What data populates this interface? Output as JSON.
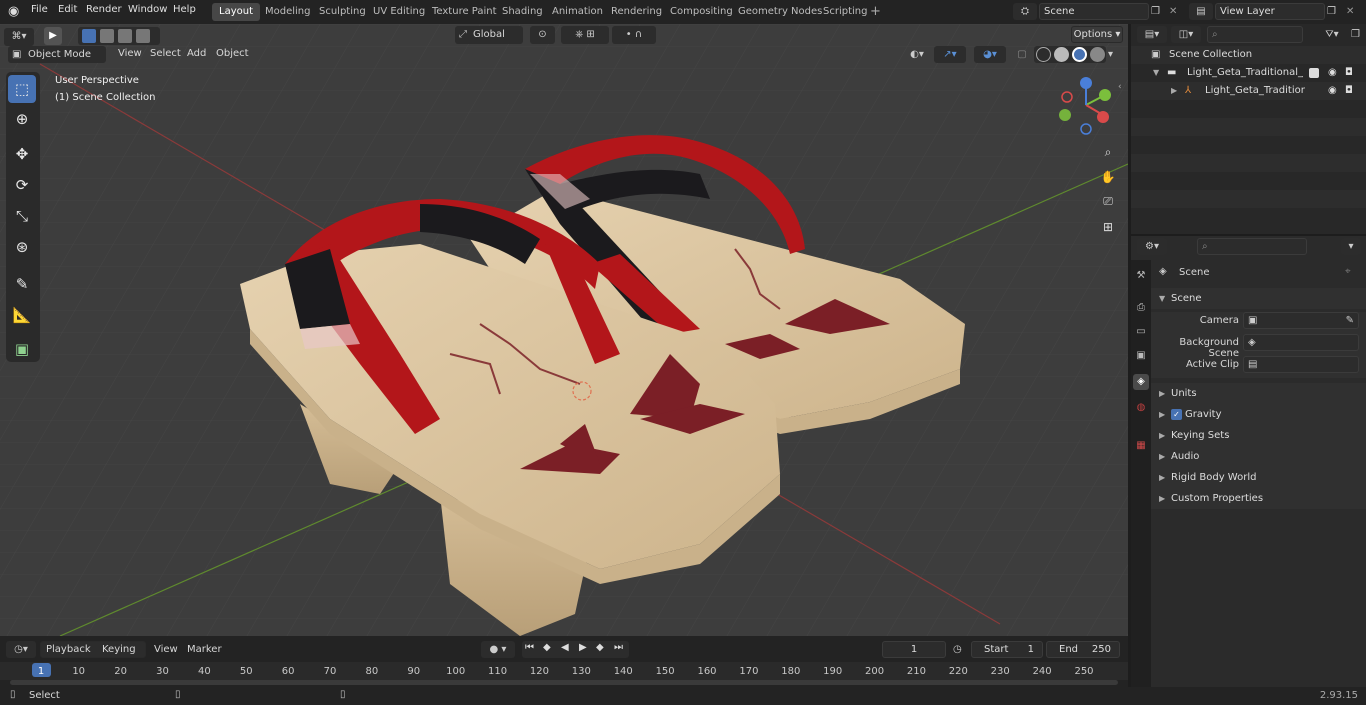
{
  "menus": [
    "File",
    "Edit",
    "Render",
    "Window",
    "Help"
  ],
  "workspaces": [
    "Layout",
    "Modeling",
    "Sculpting",
    "UV Editing",
    "Texture Paint",
    "Shading",
    "Animation",
    "Rendering",
    "Compositing",
    "Geometry Nodes",
    "Scripting"
  ],
  "scene_field": "Scene",
  "view_layer_field": "View Layer",
  "viewport": {
    "mode": "Object Mode",
    "header_menus": [
      "View",
      "Select",
      "Add",
      "Object"
    ],
    "orientation": "Global",
    "options_label": "Options",
    "overlay_line1": "User Perspective",
    "overlay_line2": "(1) Scene Collection"
  },
  "outliner": {
    "search_placeholder": "",
    "root": "Scene Collection",
    "collection": "Light_Geta_Traditional_Japanese",
    "object": "Light_Geta_Traditional_Japanese"
  },
  "properties": {
    "header_title": "Scene",
    "panel": "Scene",
    "fields": [
      {
        "label": "Camera",
        "value": ""
      },
      {
        "label": "Background Scene",
        "value": ""
      },
      {
        "label": "Active Clip",
        "value": ""
      }
    ],
    "sections": [
      "Units",
      "Gravity",
      "Keying Sets",
      "Audio",
      "Rigid Body World",
      "Custom Properties"
    ],
    "gravity_checked": true
  },
  "timeline": {
    "menus": [
      "Playback",
      "Keying",
      "View",
      "Marker"
    ],
    "current_frame": "1",
    "start_label": "Start",
    "start": "1",
    "end_label": "End",
    "end": "250",
    "ticks": [
      "1",
      "10",
      "20",
      "30",
      "40",
      "50",
      "60",
      "70",
      "80",
      "90",
      "100",
      "110",
      "120",
      "130",
      "140",
      "150",
      "160",
      "170",
      "180",
      "190",
      "200",
      "210",
      "220",
      "230",
      "240",
      "250"
    ]
  },
  "status": {
    "left": "Select",
    "version": "2.93.15"
  },
  "colors": {
    "accent": "#4772b3",
    "strap_red": "#b3161a",
    "wood": "#d9c3a0"
  }
}
